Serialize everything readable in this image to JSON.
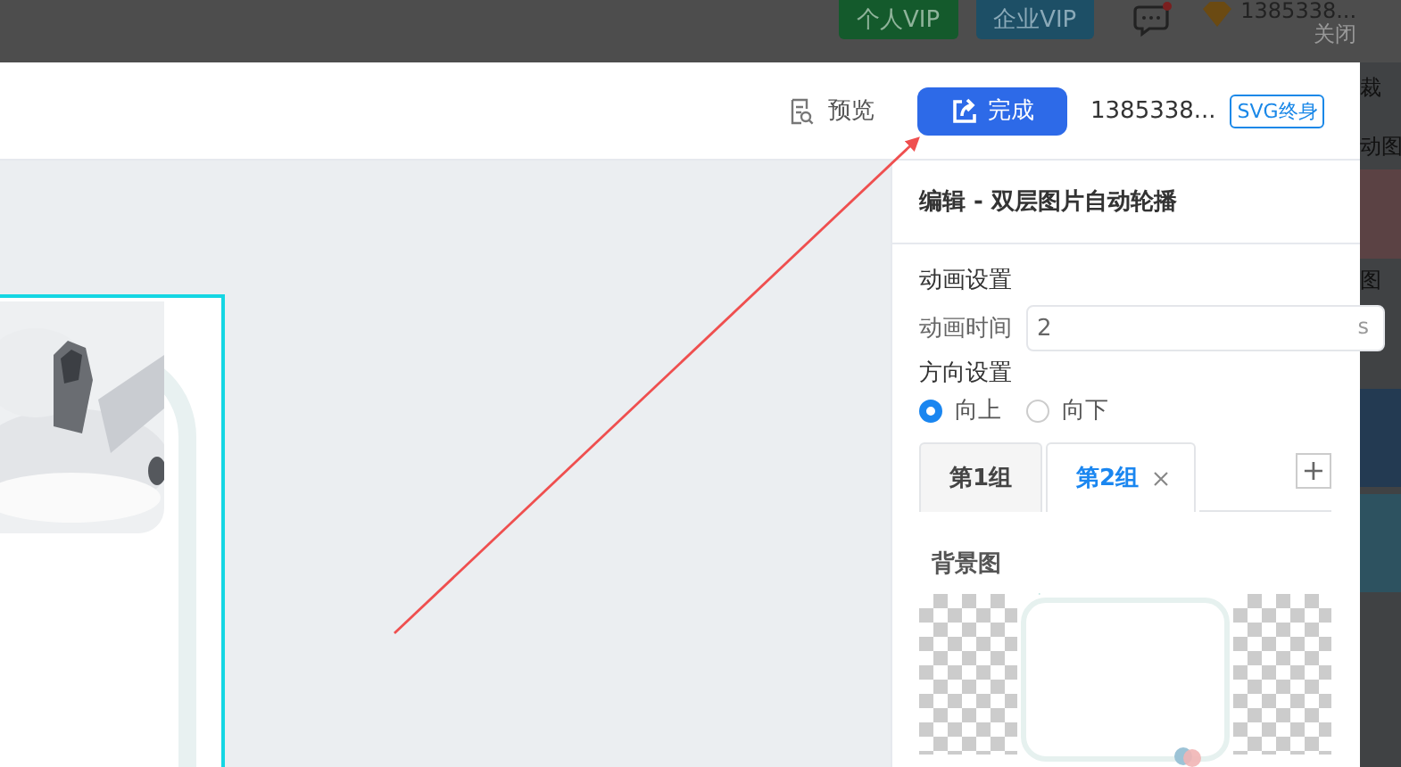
{
  "top_bar": {
    "buttons": [
      {
        "label": "个人VIP"
      },
      {
        "label": "企业VIP"
      }
    ],
    "user": "1385338...",
    "close": "关闭"
  },
  "header": {
    "preview": "预览",
    "done": "完成",
    "user": "1385338...",
    "badge": "SVG终身"
  },
  "panel": {
    "title": "编辑 - 双层图片自动轮播",
    "animation": {
      "heading": "动画设置",
      "label": "动画时间",
      "value": "2",
      "unit": "s"
    },
    "direction": {
      "heading": "方向设置",
      "options": [
        {
          "label": "向上",
          "selected": true
        },
        {
          "label": "向下",
          "selected": false
        }
      ]
    },
    "tabs": [
      {
        "label": "第1组",
        "selected": false,
        "closable": false
      },
      {
        "label": "第2组",
        "selected": true,
        "closable": true
      }
    ],
    "add": "+",
    "background": {
      "heading": "背景图"
    }
  },
  "side_strip": {
    "texts": [
      "裁",
      "动图",
      "图"
    ]
  }
}
